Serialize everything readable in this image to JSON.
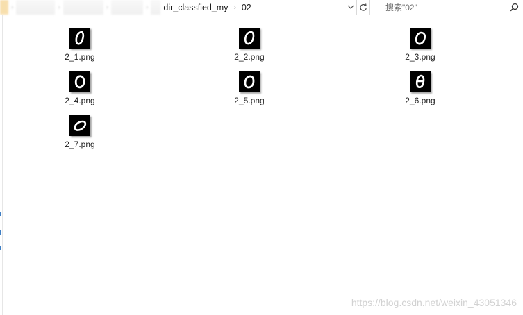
{
  "address_bar": {
    "breadcrumbs_hidden": [
      "",
      "",
      "",
      ""
    ],
    "current_path": [
      "dir_classfied_my",
      "02"
    ]
  },
  "search": {
    "placeholder": "搜索\"02\"",
    "value": ""
  },
  "files": [
    {
      "name": "2_1.png",
      "icon": "png-thumbnail-digit-0"
    },
    {
      "name": "2_2.png",
      "icon": "png-thumbnail-digit-0"
    },
    {
      "name": "2_3.png",
      "icon": "png-thumbnail-digit-0"
    },
    {
      "name": "2_4.png",
      "icon": "png-thumbnail-digit-0"
    },
    {
      "name": "2_5.png",
      "icon": "png-thumbnail-digit-0"
    },
    {
      "name": "2_6.png",
      "icon": "png-thumbnail-digit-0"
    },
    {
      "name": "2_7.png",
      "icon": "png-thumbnail-digit-0"
    }
  ],
  "watermark": "https://blog.csdn.net/weixin_43051346",
  "colors": {
    "thumbnail_bg": "#000000",
    "digit_stroke": "#ffffff",
    "nav_accent": "#3f7fc4"
  }
}
